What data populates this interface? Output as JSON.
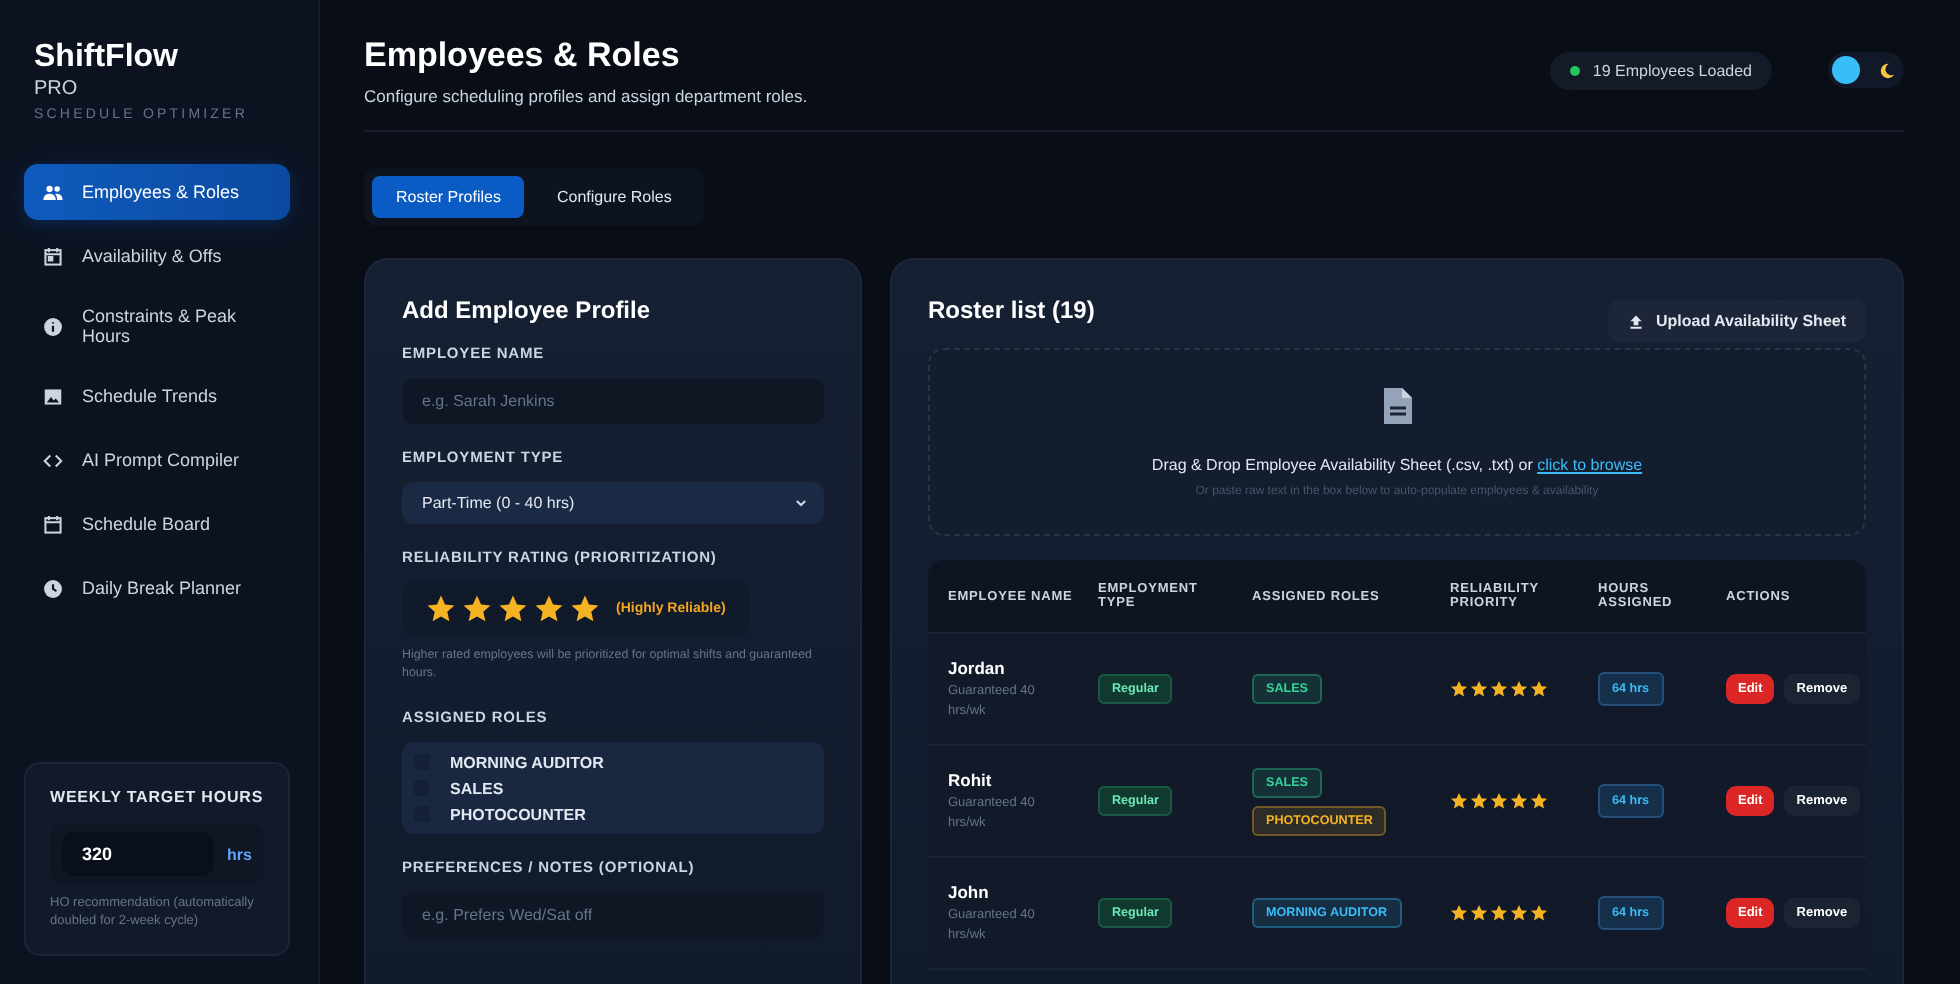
{
  "brand": {
    "name": "ShiftFlow",
    "tier": "PRO",
    "tagline": "SCHEDULE OPTIMIZER"
  },
  "nav": [
    {
      "label": "Employees & Roles",
      "selected": true
    },
    {
      "label": "Availability & Offs",
      "selected": false
    },
    {
      "label": "Constraints & Peak Hours",
      "selected": false
    },
    {
      "label": "Schedule Trends",
      "selected": false
    },
    {
      "label": "AI Prompt Compiler",
      "selected": false
    },
    {
      "label": "Schedule Board",
      "selected": false
    },
    {
      "label": "Daily Break Planner",
      "selected": false
    }
  ],
  "weekly_target": {
    "label": "WEEKLY TARGET HOURS",
    "value": "320",
    "unit": "hrs",
    "note": "HO recommendation (automatically doubled for 2-week cycle)"
  },
  "header": {
    "title": "Employees & Roles",
    "subtitle": "Configure scheduling profiles and assign department roles.",
    "status": "19 Employees Loaded",
    "light_mode": false
  },
  "tabs": [
    {
      "label": "Roster Profiles",
      "selected": true
    },
    {
      "label": "Configure Roles",
      "selected": false
    }
  ],
  "form": {
    "title": "Add Employee Profile",
    "name_label": "EMPLOYEE NAME",
    "name_placeholder": "e.g. Sarah Jenkins",
    "type_label": "EMPLOYMENT TYPE",
    "type_value": "Part-Time (0 - 40 hrs)",
    "rating_label": "RELIABILITY RATING (PRIORITIZATION)",
    "stars": 5,
    "rating_text": "(Highly Reliable)",
    "rating_hint": "Higher rated employees will be prioritized for optimal shifts and guaranteed hours.",
    "roles_label": "ASSIGNED ROLES",
    "roles": [
      {
        "label": "MORNING AUDITOR",
        "checked": false
      },
      {
        "label": "SALES",
        "checked": false
      },
      {
        "label": "PHOTOCOUNTER",
        "checked": false
      }
    ],
    "notes_label": "PREFERENCES / NOTES (OPTIONAL)",
    "notes_placeholder": "e.g. Prefers Wed/Sat off"
  },
  "roster": {
    "title": "Roster list (19)",
    "upload_button": "Upload Availability Sheet",
    "drop_text": "Drag & Drop Employee Availability Sheet (.csv, .txt) or",
    "drop_link": "click to browse",
    "drop_hint": "Or paste raw text in the box below to auto-populate employees & availability",
    "columns": [
      "EMPLOYEE NAME",
      "EMPLOYMENT TYPE",
      "ASSIGNED ROLES",
      "RELIABILITY PRIORITY",
      "HOURS ASSIGNED",
      "ACTIONS"
    ],
    "rows": [
      {
        "name": "Jordan",
        "note": "Guaranteed 40 hrs/wk",
        "type": "Regular",
        "roles": [
          {
            "label": "SALES",
            "color": "#34d399"
          }
        ],
        "stars": 5,
        "hours": "64 hrs",
        "edit": "Edit",
        "remove": "Remove"
      },
      {
        "name": "Rohit",
        "note": "Guaranteed 40 hrs/wk",
        "type": "Regular",
        "roles": [
          {
            "label": "SALES",
            "color": "#34d399"
          },
          {
            "label": "PHOTOCOUNTER",
            "color": "#f5b324"
          }
        ],
        "stars": 5,
        "hours": "64 hrs",
        "edit": "Edit",
        "remove": "Remove"
      },
      {
        "name": "John",
        "note": "Guaranteed 40 hrs/wk",
        "type": "Regular",
        "roles": [
          {
            "label": "MORNING AUDITOR",
            "color": "#38bdf8"
          }
        ],
        "stars": 5,
        "hours": "64 hrs",
        "edit": "Edit",
        "remove": "Remove"
      }
    ]
  }
}
